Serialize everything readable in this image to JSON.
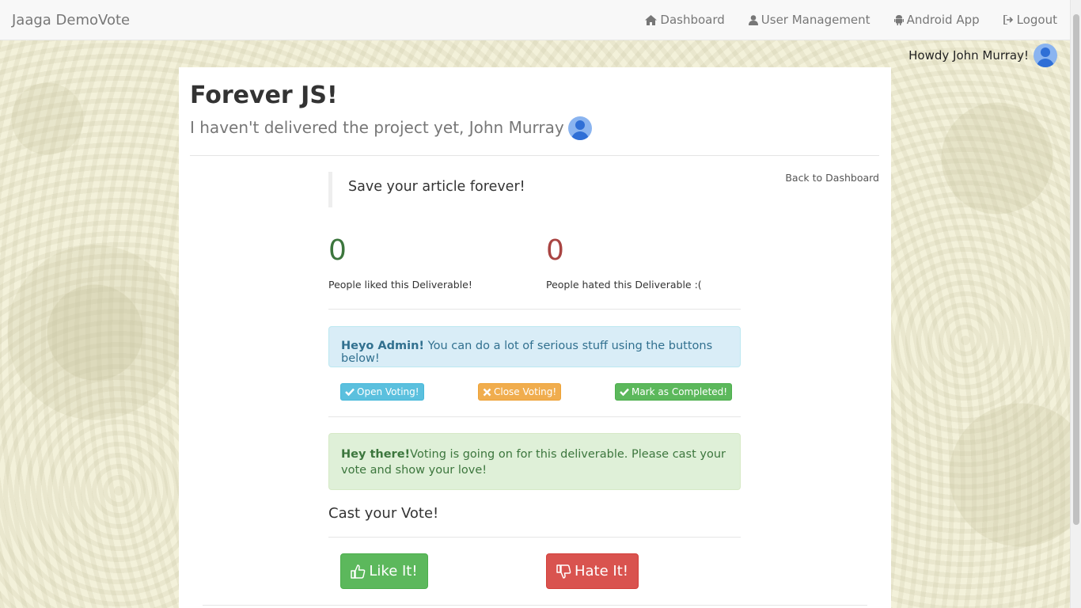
{
  "navbar": {
    "brand": "Jaaga DemoVote",
    "items": [
      {
        "label": "Dashboard",
        "icon": "home-icon"
      },
      {
        "label": "User Management",
        "icon": "user-icon"
      },
      {
        "label": "Android App",
        "icon": "android-icon"
      },
      {
        "label": "Logout",
        "icon": "logout-icon"
      }
    ]
  },
  "greeting": "Howdy John Murray!",
  "deliverable": {
    "title": "Forever JS!",
    "subtitle": "I haven't delivered the project yet, John Murray",
    "description": "Save your article forever!",
    "back_link": "Back to Dashboard"
  },
  "stats": {
    "likes": {
      "count": "0",
      "label": "People liked this Deliverable!",
      "color": "#3c763d"
    },
    "hates": {
      "count": "0",
      "label": "People hated this Deliverable :(",
      "color": "#a94442"
    }
  },
  "admin_alert": {
    "strong": "Heyo Admin!",
    "text": " You can do a lot of serious stuff using the buttons below!"
  },
  "admin_buttons": {
    "open": "Open Voting!",
    "close": "Close Voting!",
    "complete": "Mark as Completed!"
  },
  "voting_alert": {
    "strong": "Hey there!",
    "text": "Voting is going on for this deliverable. Please cast your vote and show your love!"
  },
  "cast": {
    "title": "Cast your Vote!",
    "like_label": "Like It!",
    "hate_label": "Hate It!"
  }
}
